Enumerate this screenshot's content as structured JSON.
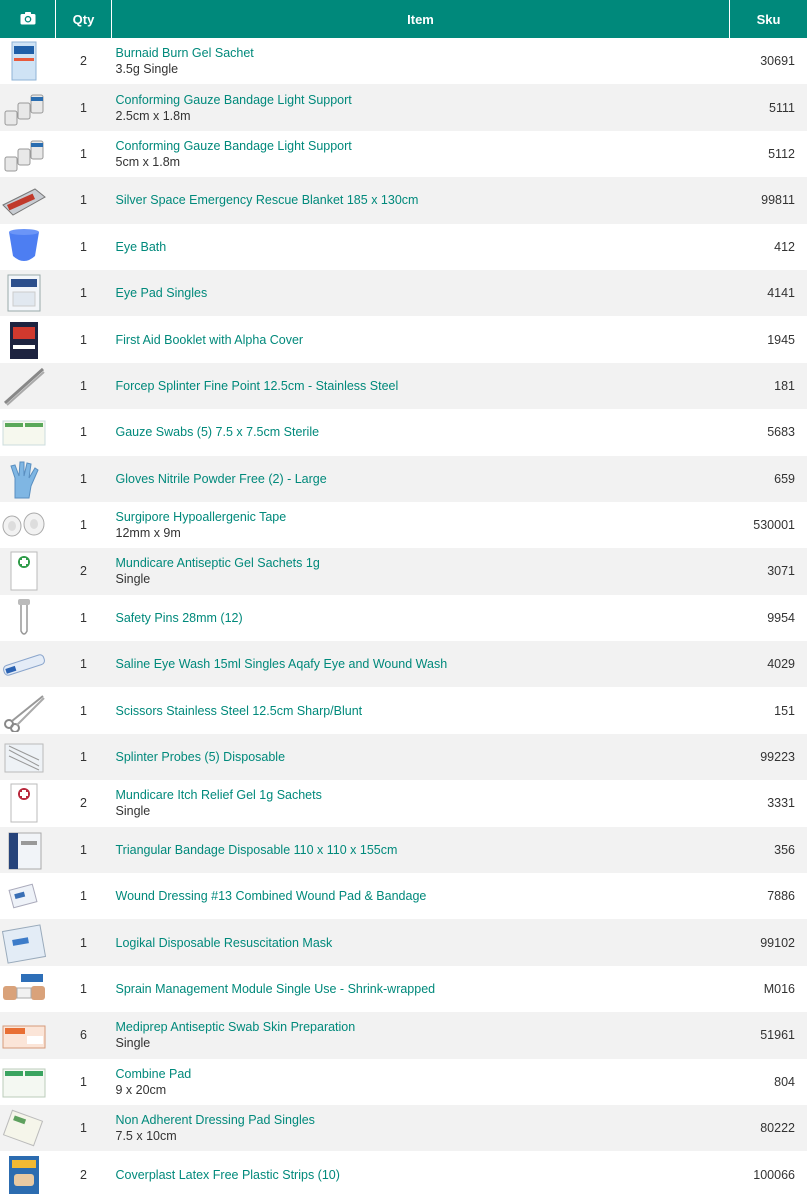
{
  "header": {
    "photo_icon": "camera-icon",
    "qty": "Qty",
    "item": "Item",
    "sku": "Sku"
  },
  "colors": {
    "accent": "#00897b",
    "row_alt": "#f2f2f2"
  },
  "rows": [
    {
      "qty": "2",
      "name": "Burnaid Burn Gel Sachet",
      "variant": "3.5g Single",
      "sku": "30691",
      "thumb": "sachet"
    },
    {
      "qty": "1",
      "name": "Conforming Gauze Bandage Light Support",
      "variant": "2.5cm x 1.8m",
      "sku": "5111",
      "thumb": "rolls"
    },
    {
      "qty": "1",
      "name": "Conforming Gauze Bandage Light Support",
      "variant": "5cm x 1.8m",
      "sku": "5112",
      "thumb": "rolls"
    },
    {
      "qty": "1",
      "name": "Silver Space Emergency Rescue Blanket 185 x 130cm",
      "variant": "",
      "sku": "99811",
      "thumb": "blanket"
    },
    {
      "qty": "1",
      "name": "Eye Bath",
      "variant": "",
      "sku": "412",
      "thumb": "eyebath"
    },
    {
      "qty": "1",
      "name": "Eye Pad Singles",
      "variant": "",
      "sku": "4141",
      "thumb": "pad"
    },
    {
      "qty": "1",
      "name": "First Aid Booklet with Alpha Cover",
      "variant": "",
      "sku": "1945",
      "thumb": "booklet"
    },
    {
      "qty": "1",
      "name": "Forcep Splinter Fine Point 12.5cm - Stainless Steel",
      "variant": "",
      "sku": "181",
      "thumb": "forcep"
    },
    {
      "qty": "1",
      "name": "Gauze Swabs (5) 7.5 x 7.5cm Sterile",
      "variant": "",
      "sku": "5683",
      "thumb": "swabs"
    },
    {
      "qty": "1",
      "name": "Gloves Nitrile Powder Free (2) - Large",
      "variant": "",
      "sku": "659",
      "thumb": "glove"
    },
    {
      "qty": "1",
      "name": "Surgipore Hypoallergenic Tape",
      "variant": "12mm x 9m",
      "sku": "530001",
      "thumb": "tape"
    },
    {
      "qty": "2",
      "name": "Mundicare Antiseptic Gel Sachets 1g",
      "variant": "Single",
      "sku": "3071",
      "thumb": "gel-green"
    },
    {
      "qty": "1",
      "name": "Safety Pins 28mm (12)",
      "variant": "",
      "sku": "9954",
      "thumb": "pin"
    },
    {
      "qty": "1",
      "name": "Saline Eye Wash 15ml Singles Aqafy Eye and Wound Wash",
      "variant": "",
      "sku": "4029",
      "thumb": "saline"
    },
    {
      "qty": "1",
      "name": "Scissors Stainless Steel 12.5cm Sharp/Blunt",
      "variant": "",
      "sku": "151",
      "thumb": "scissors"
    },
    {
      "qty": "1",
      "name": "Splinter Probes (5) Disposable",
      "variant": "",
      "sku": "99223",
      "thumb": "probes"
    },
    {
      "qty": "2",
      "name": "Mundicare Itch Relief Gel 1g Sachets",
      "variant": "Single",
      "sku": "3331",
      "thumb": "gel-red"
    },
    {
      "qty": "1",
      "name": "Triangular Bandage Disposable 110 x 110 x 155cm",
      "variant": "",
      "sku": "356",
      "thumb": "triangular"
    },
    {
      "qty": "1",
      "name": "Wound Dressing #13 Combined Wound Pad & Bandage",
      "variant": "",
      "sku": "7886",
      "thumb": "dressing"
    },
    {
      "qty": "1",
      "name": "Logikal Disposable Resuscitation Mask",
      "variant": "",
      "sku": "99102",
      "thumb": "mask"
    },
    {
      "qty": "1",
      "name": "Sprain Management Module Single Use - Shrink-wrapped",
      "variant": "",
      "sku": "M016",
      "thumb": "sprain"
    },
    {
      "qty": "6",
      "name": "Mediprep Antiseptic Swab Skin Preparation",
      "variant": "Single",
      "sku": "51961",
      "thumb": "mediprep"
    },
    {
      "qty": "1",
      "name": "Combine Pad",
      "variant": "9 x 20cm",
      "sku": "804",
      "thumb": "combine"
    },
    {
      "qty": "1",
      "name": "Non Adherent Dressing Pad Singles",
      "variant": "7.5 x 10cm",
      "sku": "80222",
      "thumb": "nonadherent"
    },
    {
      "qty": "2",
      "name": "Coverplast Latex Free Plastic Strips (10)",
      "variant": "",
      "sku": "100066",
      "thumb": "coverplast"
    }
  ]
}
